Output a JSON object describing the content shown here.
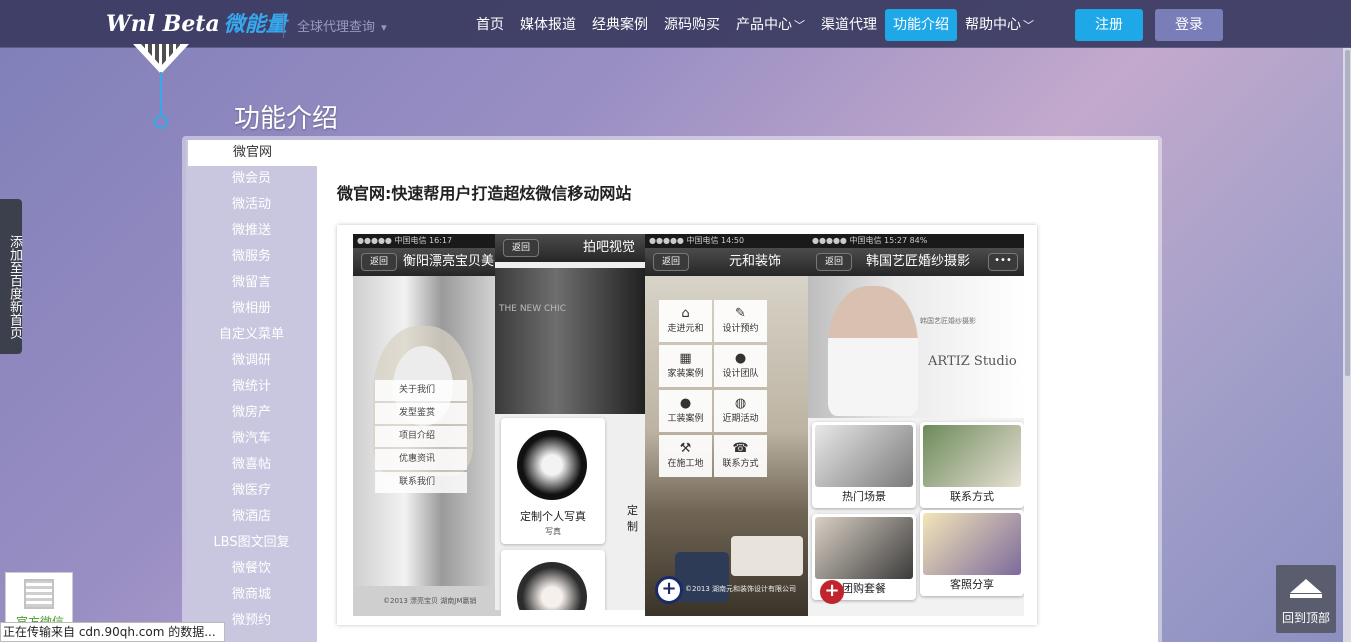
{
  "header": {
    "logo_en": "Wnl Beta",
    "logo_cn": "微能量",
    "agent_query": "全球代理查询",
    "nav": [
      {
        "label": "首页",
        "dropdown": false,
        "active": false
      },
      {
        "label": "媒体报道",
        "dropdown": false,
        "active": false
      },
      {
        "label": "经典案例",
        "dropdown": false,
        "active": false
      },
      {
        "label": "源码购买",
        "dropdown": false,
        "active": false
      },
      {
        "label": "产品中心",
        "dropdown": true,
        "active": false
      },
      {
        "label": "渠道代理",
        "dropdown": false,
        "active": false
      },
      {
        "label": "功能介绍",
        "dropdown": false,
        "active": true
      },
      {
        "label": "帮助中心",
        "dropdown": true,
        "active": false
      }
    ],
    "register_label": "注册",
    "login_label": "登录"
  },
  "page_title": "功能介绍",
  "sidebar": {
    "items": [
      {
        "label": "微官网",
        "active": true
      },
      {
        "label": "微会员",
        "active": false
      },
      {
        "label": "微活动",
        "active": false
      },
      {
        "label": "微推送",
        "active": false
      },
      {
        "label": "微服务",
        "active": false
      },
      {
        "label": "微留言",
        "active": false
      },
      {
        "label": "微相册",
        "active": false
      },
      {
        "label": "自定义菜单",
        "active": false
      },
      {
        "label": "微调研",
        "active": false
      },
      {
        "label": "微统计",
        "active": false
      },
      {
        "label": "微房产",
        "active": false
      },
      {
        "label": "微汽车",
        "active": false
      },
      {
        "label": "微喜帖",
        "active": false
      },
      {
        "label": "微医疗",
        "active": false
      },
      {
        "label": "微酒店",
        "active": false
      },
      {
        "label": "LBS图文回复",
        "active": false
      },
      {
        "label": "微餐饮",
        "active": false
      },
      {
        "label": "微商城",
        "active": false
      },
      {
        "label": "微预约",
        "active": false
      }
    ]
  },
  "main": {
    "heading": "微官网:快速帮用户打造超炫微信移动网站",
    "phones": {
      "p1": {
        "status": "●●●●● 中国电信  16:17",
        "back": "返回",
        "title": "衡阳漂亮宝贝美",
        "menu": [
          "关于我们",
          "发型鉴赏",
          "项目介绍",
          "优惠资讯",
          "联系我们"
        ],
        "footer": "©2013 漂亮宝贝 湖南JM赢销"
      },
      "p2": {
        "back": "返回",
        "title": "拍吧视觉",
        "photo_text": "THE NEW CHIC",
        "card_title": "定制个人写真",
        "card_sub": "写真",
        "side_text": "定制"
      },
      "p3": {
        "status": "●●●●● 中国电信  14:50",
        "back": "返回",
        "title": "元和装饰",
        "tiles": [
          {
            "icon": "⌂",
            "label": "走进元和"
          },
          {
            "icon": "✎",
            "label": "设计预约"
          },
          {
            "icon": "▦",
            "label": "家装案例"
          },
          {
            "icon": "●",
            "label": "设计团队"
          },
          {
            "icon": "●",
            "label": "工装案例"
          },
          {
            "icon": "◍",
            "label": "近期活动"
          },
          {
            "icon": "⚒",
            "label": "在施工地"
          },
          {
            "icon": "☎",
            "label": "联系方式"
          }
        ],
        "footer": "©2013 湖南元和装饰设计有限公司"
      },
      "p4": {
        "status": "●●●●● 中国电信  15:27  84%",
        "back": "返回",
        "title": "韩国艺匠婚纱摄影",
        "more": "•••",
        "studio": "ARTIZ Studio",
        "studio_cn": "韩国艺匠婚纱摄影",
        "cells": [
          "热门场景",
          "联系方式",
          "团购套餐",
          "客照分享"
        ]
      }
    }
  },
  "floating": {
    "fav_tab": "添加至百度新首页",
    "qr_label": "官方微信",
    "back_top": "回到顶部"
  },
  "status_bar": "正在传输来自 cdn.90qh.com 的数据..."
}
